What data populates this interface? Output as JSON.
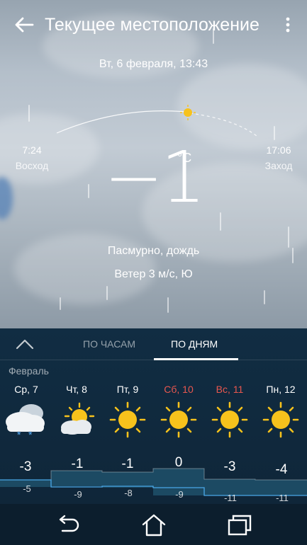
{
  "header": {
    "title": "Текущее местоположение",
    "back_icon": "arrow-left-icon",
    "menu_icon": "more-vertical-icon"
  },
  "current": {
    "date": "Вт, 6 февраля, 13:43",
    "sunrise_time": "7:24",
    "sunrise_label": "Восход",
    "sunset_time": "17:06",
    "sunset_label": "Заход",
    "temperature": "−1",
    "unit": "°C",
    "condition": "Пасмурно,  дождь",
    "wind": "Ветер 3 м/с, Ю"
  },
  "tabs": {
    "hourly": "ПО ЧАСАМ",
    "daily": "ПО ДНЯМ",
    "active": "daily"
  },
  "forecast": {
    "month": "Февраль",
    "days": [
      {
        "label": "Ср, 7",
        "icon": "cloud-snow-icon",
        "high": "-3",
        "low": "-5",
        "weekend": false
      },
      {
        "label": "Чт, 8",
        "icon": "partly-cloudy-icon",
        "high": "-1",
        "low": "-9",
        "weekend": false
      },
      {
        "label": "Пт, 9",
        "icon": "sun-icon",
        "high": "-1",
        "low": "-8",
        "weekend": false
      },
      {
        "label": "Сб, 10",
        "icon": "sun-icon",
        "high": "0",
        "low": "-9",
        "weekend": true
      },
      {
        "label": "Вс, 11",
        "icon": "sun-icon",
        "high": "-3",
        "low": "-11",
        "weekend": true
      },
      {
        "label": "Пн, 12",
        "icon": "sun-icon",
        "high": "-4",
        "low": "-11",
        "weekend": false
      }
    ]
  },
  "colors": {
    "weekend": "#e8574f",
    "sun": "#f7c21c",
    "snow": "#5cb3ff",
    "panel": "#112d43"
  },
  "navbar": {
    "back_icon": "nav-back-icon",
    "home_icon": "nav-home-icon",
    "recents_icon": "nav-recents-icon"
  }
}
